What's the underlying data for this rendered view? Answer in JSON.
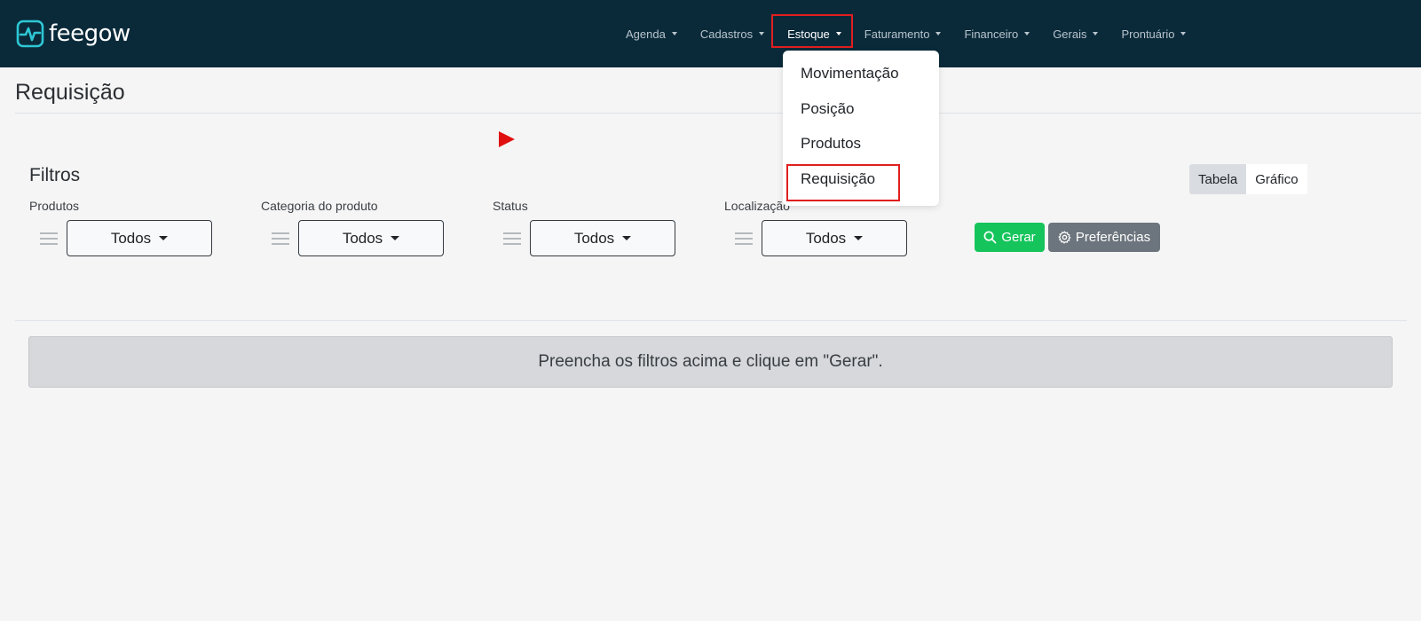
{
  "app": {
    "logo_text": "feegow",
    "brand_colors": {
      "navbar": "#0a2a3a",
      "logo_mark": "#2ec7d4",
      "highlight": "#e01f1f"
    }
  },
  "nav": {
    "items": [
      {
        "label": "Agenda"
      },
      {
        "label": "Cadastros"
      },
      {
        "label": "Estoque"
      },
      {
        "label": "Faturamento"
      },
      {
        "label": "Financeiro"
      },
      {
        "label": "Gerais"
      },
      {
        "label": "Prontuário"
      }
    ],
    "active": "Estoque"
  },
  "dropdown": {
    "items": [
      {
        "label": "Movimentação"
      },
      {
        "label": "Posição"
      },
      {
        "label": "Produtos"
      },
      {
        "label": "Requisição"
      }
    ],
    "highlighted": "Requisição"
  },
  "page": {
    "title": "Requisição"
  },
  "filters": {
    "title": "Filtros",
    "fields": [
      {
        "label": "Produtos",
        "value": "Todos"
      },
      {
        "label": "Categoria do produto",
        "value": "Todos"
      },
      {
        "label": "Status",
        "value": "Todos"
      },
      {
        "label": "Localização",
        "value": "Todos"
      }
    ]
  },
  "actions": {
    "gerar_label": "Gerar",
    "gerar_icon": "search-icon",
    "preferencias_label": "Preferências",
    "preferencias_icon": "gear-icon"
  },
  "view_toggle": {
    "options": [
      "Tabela",
      "Gráfico"
    ],
    "selected": "Tabela"
  },
  "results": {
    "message": "Preencha os filtros acima e clique em \"Gerar\"."
  }
}
